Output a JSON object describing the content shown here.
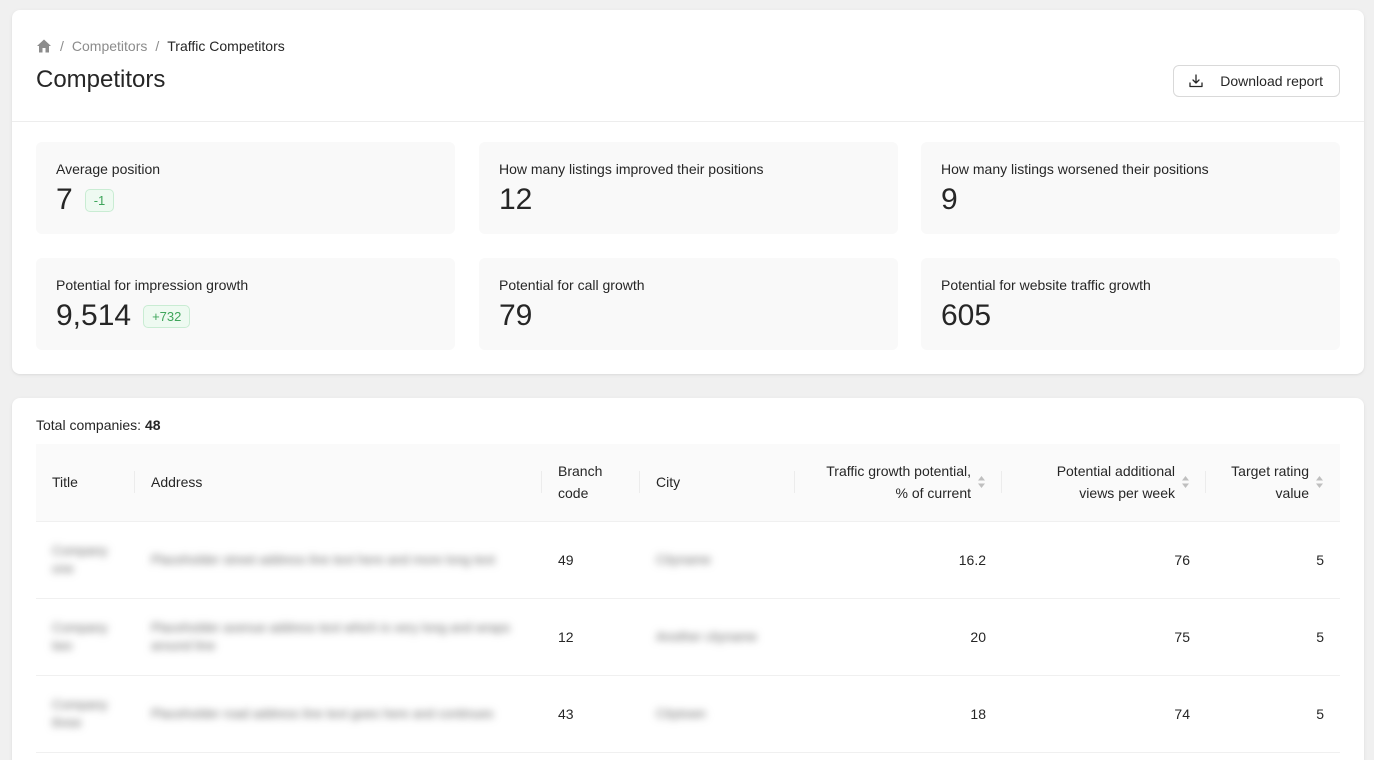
{
  "breadcrumb": {
    "home_icon": "home-icon",
    "separator": "/",
    "items": [
      "Competitors",
      "Traffic Competitors"
    ]
  },
  "page": {
    "title": "Competitors",
    "download_label": "Download report",
    "download_icon": "download-icon"
  },
  "stats": [
    {
      "label": "Average position",
      "value": "7",
      "badge": "-1"
    },
    {
      "label": "How many listings improved their positions",
      "value": "12",
      "badge": ""
    },
    {
      "label": "How many listings worsened their positions",
      "value": "9",
      "badge": ""
    },
    {
      "label": "Potential for impression growth",
      "value": "9,514",
      "badge": "+732"
    },
    {
      "label": "Potential for call growth",
      "value": "79",
      "badge": ""
    },
    {
      "label": "Potential for website traffic growth",
      "value": "605",
      "badge": ""
    }
  ],
  "colors": {
    "badge_text": "#3fa55b",
    "badge_bg": "#eefaf1",
    "page_bg": "#f0f0f0"
  },
  "table": {
    "total_label": "Total companies:",
    "total_value": "48",
    "columns": [
      "Title",
      "Address",
      "Branch code",
      "City",
      "Traffic growth potential, % of current",
      "Potential additional views per week",
      "Target rating value"
    ],
    "rows": [
      {
        "title": "Company one",
        "address": "Placeholder street address line text here and more long text",
        "branch": "49",
        "city": "Cityname",
        "traffic": "16.2",
        "views": "76",
        "rating": "5"
      },
      {
        "title": "Company two",
        "address": "Placeholder avenue address text which is very long and wraps around line",
        "branch": "12",
        "city": "Another cityname",
        "traffic": "20",
        "views": "75",
        "rating": "5"
      },
      {
        "title": "Company three",
        "address": "Placeholder road address line text goes here and continues",
        "branch": "43",
        "city": "Citytown",
        "traffic": "18",
        "views": "74",
        "rating": "5"
      }
    ]
  }
}
